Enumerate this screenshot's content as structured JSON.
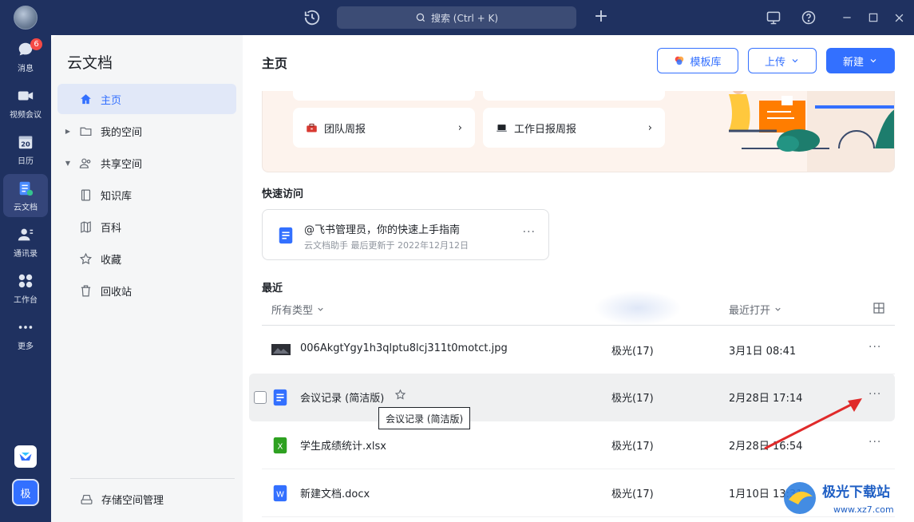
{
  "titlebar": {
    "search_placeholder": "搜索 (Ctrl + K)"
  },
  "rail": {
    "items": [
      {
        "label": "消息",
        "badge": "6"
      },
      {
        "label": "视频会议"
      },
      {
        "label": "日历",
        "day": "20"
      },
      {
        "label": "云文档"
      },
      {
        "label": "通讯录"
      },
      {
        "label": "工作台"
      },
      {
        "label": "更多"
      }
    ],
    "user_initial": "极"
  },
  "sidebar": {
    "title": "云文档",
    "items": [
      {
        "label": "主页"
      },
      {
        "label": "我的空间"
      },
      {
        "label": "共享空间"
      },
      {
        "label": "知识库"
      },
      {
        "label": "百科"
      },
      {
        "label": "收藏"
      },
      {
        "label": "回收站"
      }
    ],
    "storage_label": "存储空间管理"
  },
  "main": {
    "title": "主页",
    "template_btn": "模板库",
    "upload_btn": "上传",
    "new_btn": "新建",
    "banner_cards": [
      "团队周报",
      "工作日报周报"
    ],
    "quick_access_title": "快速访问",
    "quick_card": {
      "title": "@飞书管理员，你的快速上手指南",
      "subtitle": "云文档助手 最后更新于 2022年12月12日"
    },
    "recent_title": "最近",
    "filter_type": "所有类型",
    "sort_label": "最近打开",
    "files": [
      {
        "name": "006AkgtYgy1h3qlptu8lcj311t0motct.jpg",
        "owner": "极光(17)",
        "time": "3月1日 08:41"
      },
      {
        "name": "会议记录 (简洁版)",
        "owner": "极光(17)",
        "time": "2月28日 17:14"
      },
      {
        "name": "学生成绩统计.xlsx",
        "owner": "极光(17)",
        "time": "2月28日 16:54"
      },
      {
        "name": "新建文档.docx",
        "owner": "极光(17)",
        "time": "1月10日 13:31"
      }
    ],
    "tooltip": "会议记录 (简洁版)"
  },
  "watermark": {
    "text": "极光下载站",
    "url": "www.xz7.com"
  },
  "colors": {
    "accent": "#3370ff",
    "rail": "#1f3160",
    "arrow": "#e02a2a"
  }
}
